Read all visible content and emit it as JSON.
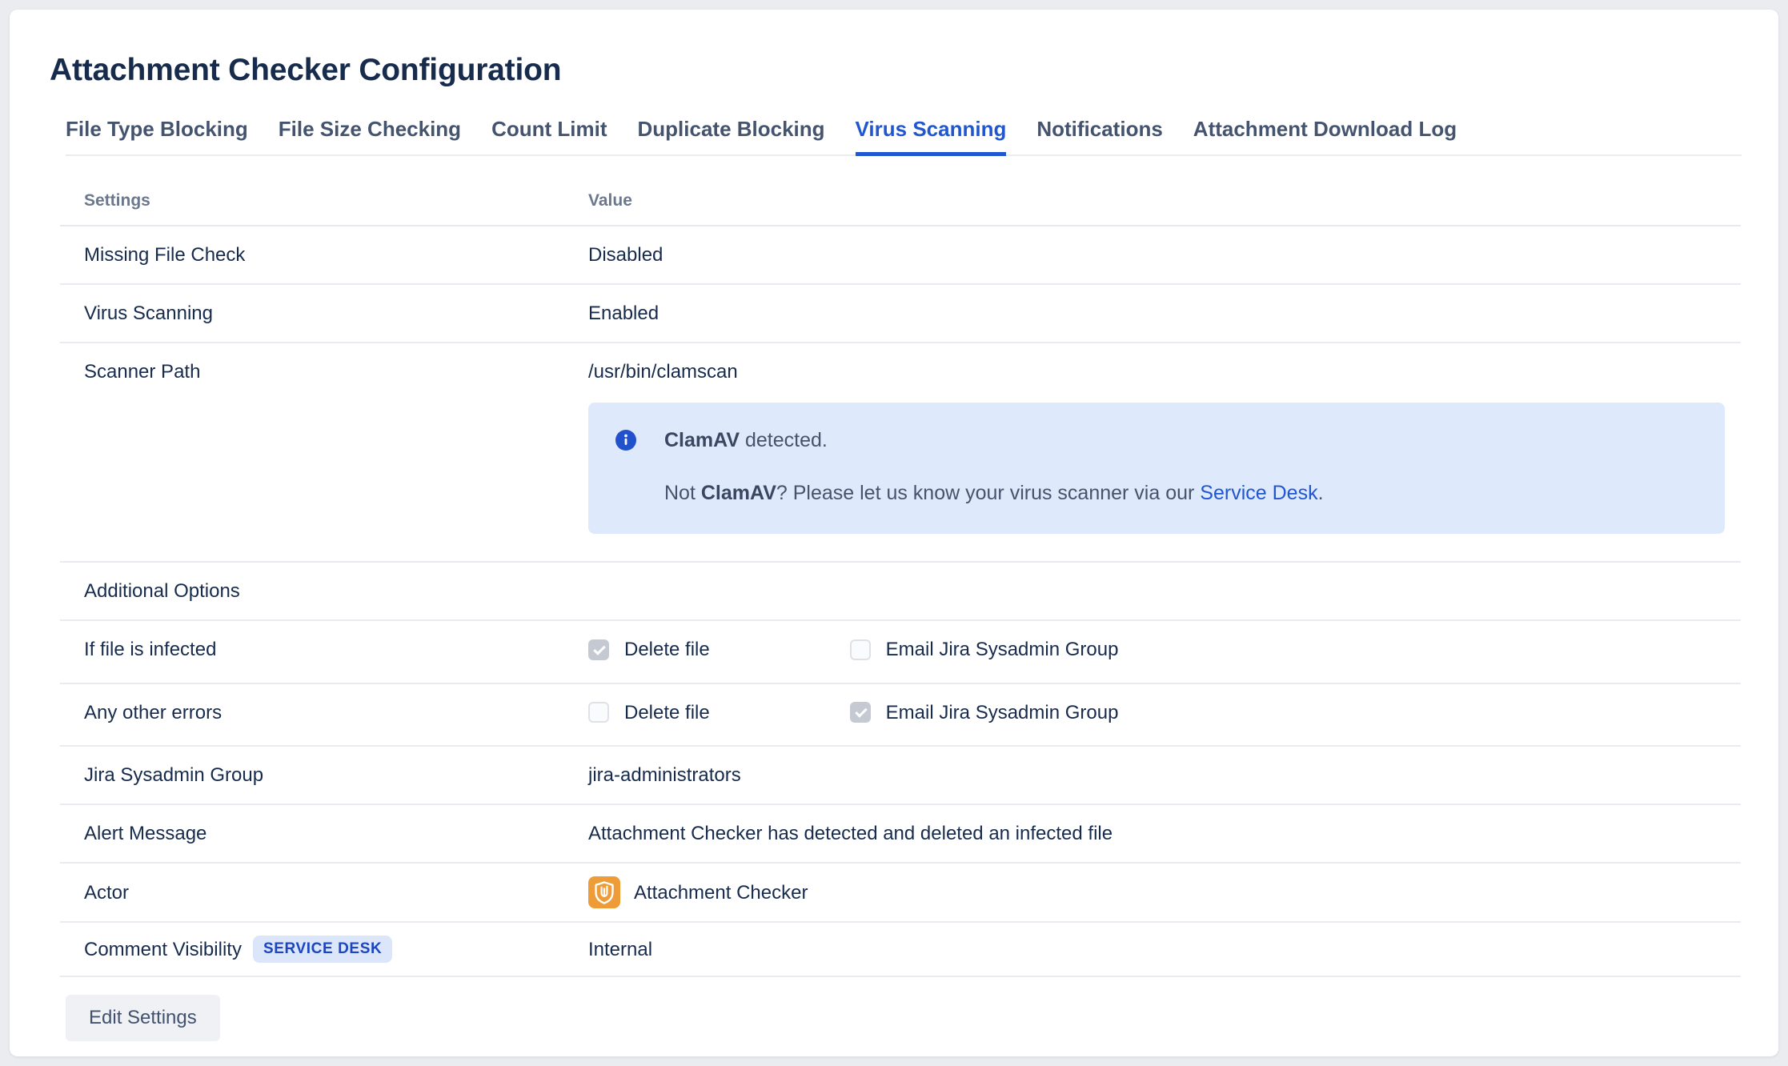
{
  "title": "Attachment Checker Configuration",
  "tabs": [
    {
      "label": "File Type Blocking",
      "active": false
    },
    {
      "label": "File Size Checking",
      "active": false
    },
    {
      "label": "Count Limit",
      "active": false
    },
    {
      "label": "Duplicate Blocking",
      "active": false
    },
    {
      "label": "Virus Scanning",
      "active": true
    },
    {
      "label": "Notifications",
      "active": false
    },
    {
      "label": "Attachment Download Log",
      "active": false
    }
  ],
  "table": {
    "headers": {
      "settings": "Settings",
      "value": "Value"
    },
    "rows": {
      "missing_file_check": {
        "label": "Missing File Check",
        "value": "Disabled"
      },
      "virus_scanning": {
        "label": "Virus Scanning",
        "value": "Enabled"
      },
      "scanner_path": {
        "label": "Scanner Path",
        "value": "/usr/bin/clamscan"
      },
      "additional_options": {
        "label": "Additional Options"
      },
      "if_file_infected": {
        "label": "If file is infected",
        "options": [
          {
            "label": "Delete file",
            "checked": true
          },
          {
            "label": "Email Jira Sysadmin Group",
            "checked": false
          }
        ]
      },
      "any_other_errors": {
        "label": "Any other errors",
        "options": [
          {
            "label": "Delete file",
            "checked": false
          },
          {
            "label": "Email Jira Sysadmin Group",
            "checked": true
          }
        ]
      },
      "jira_sysadmin_group": {
        "label": "Jira Sysadmin Group",
        "value": "jira-administrators"
      },
      "alert_message": {
        "label": "Alert Message",
        "value": "Attachment Checker has detected and deleted an infected file"
      },
      "actor": {
        "label": "Actor",
        "icon": "shield-paperclip-icon",
        "value": "Attachment Checker"
      },
      "comment_visibility": {
        "label": "Comment Visibility",
        "badge": "SERVICE DESK",
        "value": "Internal"
      }
    }
  },
  "info_panel": {
    "icon": "info-icon",
    "line1": {
      "bold": "ClamAV",
      "rest": " detected."
    },
    "line2": {
      "prefix": "Not ",
      "bold": "ClamAV",
      "middle": "? Please let us know your virus scanner via our ",
      "link": "Service Desk",
      "suffix": "."
    }
  },
  "actions": {
    "edit_settings": "Edit Settings"
  },
  "colors": {
    "accent_blue": "#2156D2",
    "panel_background": "#DEE9FC",
    "badge_background": "#DBE6FB",
    "badge_text": "#1C46BE",
    "actor_icon_orange": "#EE9C37",
    "heading_navy": "#172B4D",
    "muted_header_gray": "#6B778C",
    "checkbox_checked_gray": "#C4C9D2"
  }
}
